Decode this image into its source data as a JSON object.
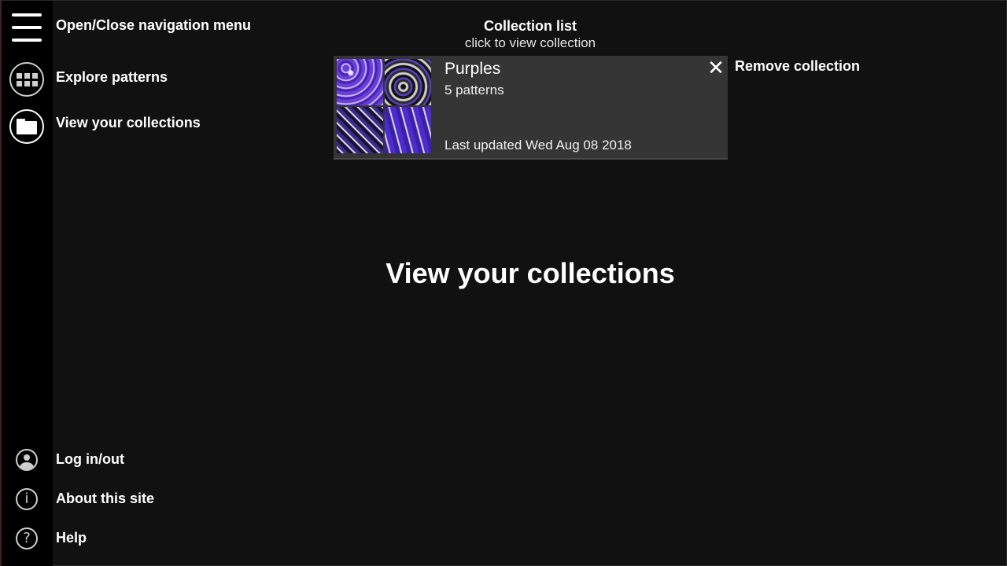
{
  "sidebar": {
    "menu_label": "Open/Close navigation menu",
    "explore_label": "Explore patterns",
    "collections_label": "View your collections",
    "login_label": "Log in/out",
    "about_label": "About this site",
    "help_label": "Help",
    "icons": [
      "hamburger-icon",
      "grid-icon",
      "folder-icon",
      "user-icon",
      "info-icon",
      "help-icon"
    ]
  },
  "header": {
    "title": "Collection list",
    "subtitle": "click to view collection"
  },
  "collection": {
    "name": "Purples",
    "count": "5 patterns",
    "updated": "Last updated Wed Aug 08 2018",
    "remove_label": "Remove collection"
  },
  "main": {
    "title": "View your collections"
  },
  "colors": {
    "background": "#111111",
    "sidebar": "#000000",
    "card": "#353535",
    "text": "#ffffff",
    "accent_purple": "#5b3cc4"
  }
}
